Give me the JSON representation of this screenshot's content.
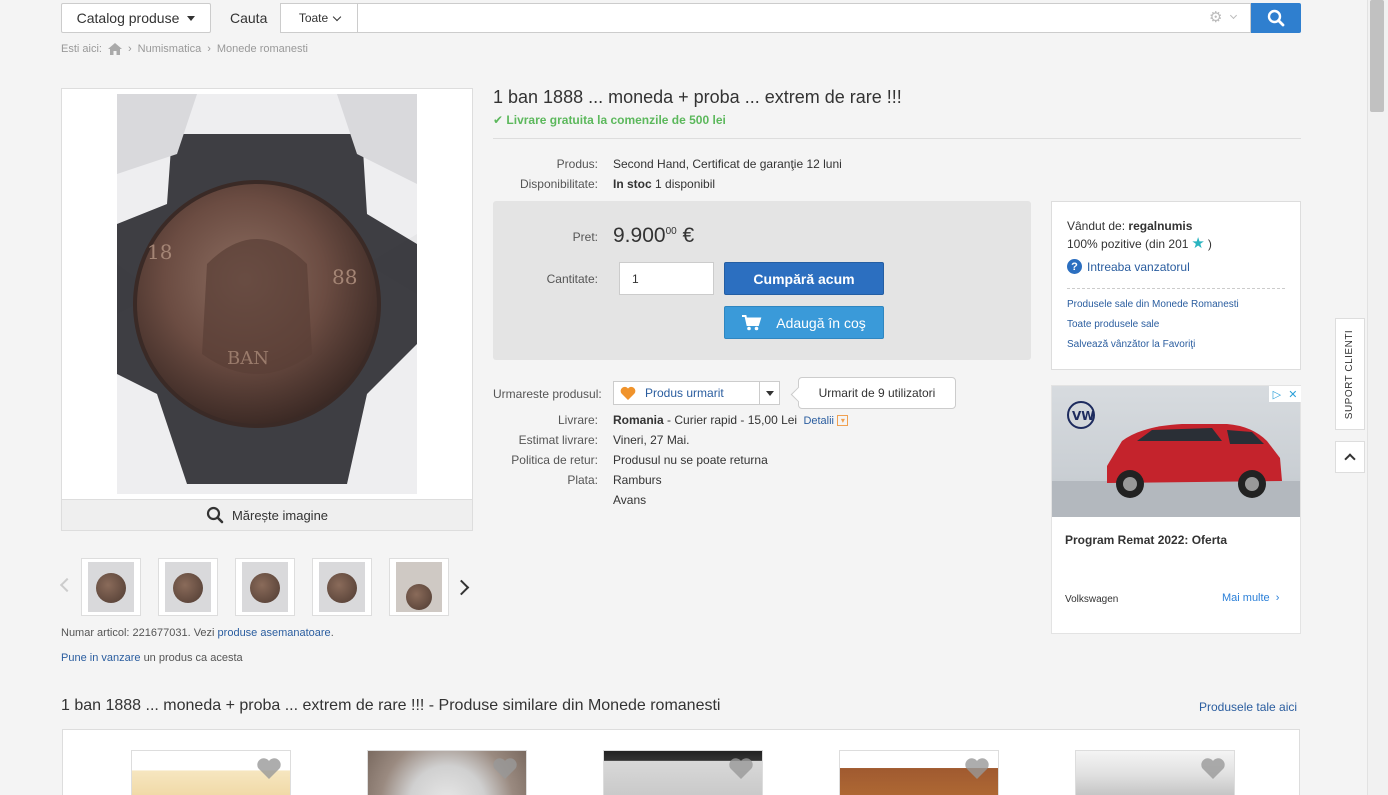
{
  "header": {
    "catalog_label": "Catalog produse",
    "search_label": "Cauta",
    "category_select": "Toate",
    "search_placeholder": ""
  },
  "breadcrumb": {
    "prefix": "Esti aici:",
    "items": [
      "Numismatica",
      "Monede romanesti"
    ]
  },
  "gallery": {
    "zoom_label": "Mărește imagine",
    "thumbnails_count": 5
  },
  "article": {
    "number_text": "Numar articol: 221677031. Vezi",
    "similar_link": "produse asemanatoare",
    "sell_link": "Pune in vanzare",
    "sell_rest": "un produs ca acesta"
  },
  "product": {
    "title": "1 ban 1888 ... moneda + proba ... extrem de rare !!!",
    "free_shipping": "Livrare gratuita la comenzile de 500 lei",
    "details": [
      {
        "label": "Produs:",
        "value": "Second Hand, Certificat de garanţie 12 luni"
      },
      {
        "label": "Disponibilitate:",
        "value_bold": "In stoc",
        "value": "1 disponibil"
      }
    ],
    "price_label": "Pret:",
    "price_main": "9.900",
    "price_decimals": "00",
    "currency": "€",
    "qty_label": "Cantitate:",
    "qty_value": "1",
    "buy_label": "Cumpără acum",
    "cart_label": "Adaugă în coş",
    "follow_label": "Urmareste produsul:",
    "follow_value": "Produs urmarit",
    "followers": "Urmarit de 9 utilizatori",
    "shipping_label": "Livrare:",
    "shipping_country": "Romania",
    "shipping_value": "- Curier rapid - 15,00 Lei",
    "shipping_details": "Detalii",
    "estimate_label": "Estimat livrare:",
    "estimate_value": "Vineri, 27 Mai.",
    "return_label": "Politica de retur:",
    "return_value": "Produsul nu se poate returna",
    "payment_label": "Plata:",
    "payment_methods": [
      "Ramburs",
      "Avans"
    ]
  },
  "seller": {
    "sold_by_label": "Vândut de:",
    "name": "regalnumis",
    "rating_text": "100% pozitive (din 201",
    "rating_close": ")",
    "ask_label": "Intreaba vanzatorul",
    "links": [
      "Produsele sale din Monede Romanesti",
      "Toate produsele sale",
      "Salvează vânzător la Favoriţi"
    ]
  },
  "ad": {
    "title": "Program Remat 2022: Oferta",
    "advertiser": "Volkswagen",
    "more_label": "Mai multe"
  },
  "side": {
    "support_label": "SUPORT CLIENTI"
  },
  "similar": {
    "title": "1 ban 1888 ... moneda + proba ... extrem de rare !!! - Produse similare din Monede romanesti",
    "own_link": "Produsele tale aici"
  },
  "colors": {
    "accent": "#2c6fc0",
    "success": "#5cb85c",
    "heart": "#f0932b"
  }
}
